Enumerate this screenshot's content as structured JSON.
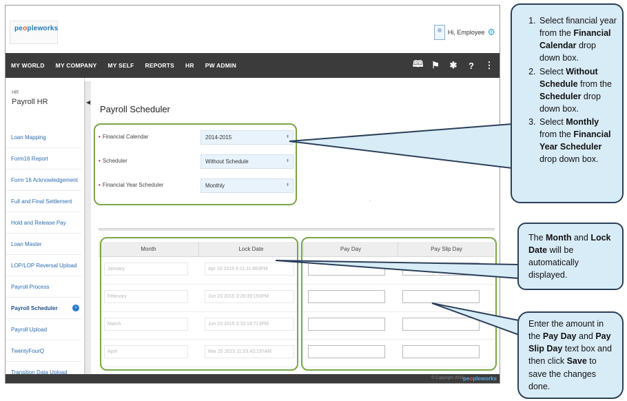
{
  "header": {
    "logo_text_a": "pe",
    "logo_text_b": "o",
    "logo_text_c": "pleworks",
    "greeting": "Hi, Employee"
  },
  "nav": {
    "items": [
      "MY WORLD",
      "MY COMPANY",
      "MY SELF",
      "REPORTS",
      "HR",
      "PW ADMIN"
    ],
    "icons": [
      "book-icon",
      "flag-icon",
      "tools-icon",
      "help-icon",
      "share-icon"
    ]
  },
  "sidebar": {
    "module": "HR",
    "title": "Payroll HR",
    "items": [
      "Loan Mapping",
      "Form16 Report",
      "Form 16 Acknowledgement",
      "Full and Final Settlement",
      "Hold and Release Pay",
      "Loan Master",
      "LOP/LOP Reversal Upload",
      "Payroll Process",
      "Payroll Scheduler",
      "Payroll Upload",
      "TwentyFourQ",
      "Transition Data Upload"
    ],
    "active_index": 8
  },
  "main": {
    "title": "Payroll Scheduler",
    "form": {
      "financial_calendar_label": "Financial Calendar",
      "financial_calendar_value": "2014-2015",
      "scheduler_label": "Scheduler",
      "scheduler_value": "Without Schedule",
      "fy_scheduler_label": "Financial Year Scheduler",
      "fy_scheduler_value": "Monthly"
    },
    "table": {
      "headers": [
        "Month",
        "Lock Date",
        "Pay Day",
        "Pay Slip Day"
      ],
      "rows": [
        {
          "month": "January",
          "lock_date": "Apr 10 2015 6:11:11:863PM"
        },
        {
          "month": "February",
          "lock_date": "Jun 23 2015 3:28:39:193PM"
        },
        {
          "month": "March",
          "lock_date": "Jun 23 2015 3:33:18:713PM"
        },
        {
          "month": "April",
          "lock_date": "Mar 25 2015 11:53:43:197AM"
        }
      ]
    }
  },
  "footer": {
    "copyright": "© Copyright 2015",
    "logo_a": "pe",
    "logo_b": "o",
    "logo_c": "pleworks"
  },
  "callouts": {
    "top": {
      "step1": {
        "pre": "Select financial year from the ",
        "bold": "Financial Calendar",
        "post": " drop down box."
      },
      "step2": {
        "pre": "Select ",
        "bold1": "Without Schedule",
        "mid": " from the ",
        "bold2": "Scheduler",
        "post": " drop down box."
      },
      "step3": {
        "pre": "Select ",
        "bold1": "Monthly",
        "mid": " from the ",
        "bold2": "Financial Year Scheduler",
        "post": " drop down box."
      }
    },
    "middle": {
      "pre": "The ",
      "bold1": "Month",
      "mid": " and ",
      "bold2": "Lock Date",
      "post": " will be automatically displayed."
    },
    "bottom": {
      "pre": "Enter the amount in the ",
      "bold1": "Pay Day",
      "mid1": " and ",
      "bold2": "Pay Slip Day",
      "mid2": " text box and then click ",
      "bold3": "Save",
      "post": " to save the changes done."
    }
  },
  "colors": {
    "nav_bg": "#3b3b3b",
    "highlight": "#78a745",
    "callout_fill": "#d8ecf7",
    "callout_border": "#2b3f58",
    "link_blue": "#2b6cb0"
  }
}
